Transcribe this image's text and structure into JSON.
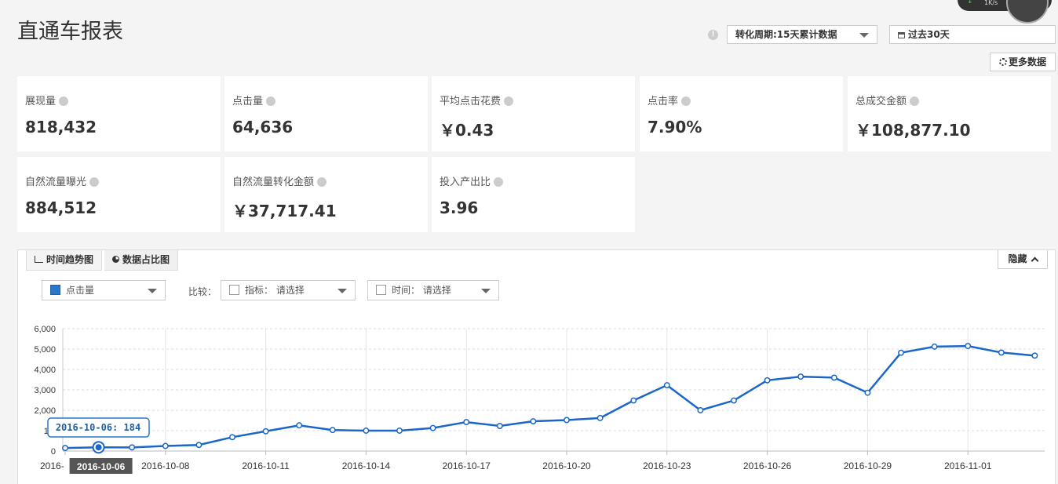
{
  "header": {
    "title": "直通车报表"
  },
  "speed": {
    "text": "1K/s"
  },
  "controls": {
    "period_label": "转化周期:15天累计数据",
    "range_label": "过去30天",
    "more_label": "更多数据"
  },
  "metrics": [
    {
      "label": "展现量",
      "value": "818,432"
    },
    {
      "label": "点击量",
      "value": "64,636"
    },
    {
      "label": "平均点击花费",
      "value": "￥0.43"
    },
    {
      "label": "点击率",
      "value": "7.90%"
    },
    {
      "label": "总成交金额",
      "value": "￥108,877.10"
    },
    {
      "label": "自然流量曝光",
      "value": "884,512"
    },
    {
      "label": "自然流量转化金额",
      "value": "￥37,717.41"
    },
    {
      "label": "投入产出比",
      "value": "3.96"
    }
  ],
  "chart_panel": {
    "tab_trend": "时间趋势图",
    "tab_share": "数据占比图",
    "hide_label": "隐藏",
    "metric_select": "点击量",
    "compare_label": "比较：",
    "compare_metric": "指标： 请选择",
    "compare_time": "时间： 请选择"
  },
  "colors": {
    "series": "#1a66c9",
    "tooltip_border": "#2b78c8",
    "date_badge_bg": "#555555"
  },
  "chart_data": {
    "type": "line",
    "series": [
      {
        "values": [
          150,
          184,
          180,
          250,
          300,
          680,
          970,
          1260,
          1030,
          1000,
          1000,
          1130,
          1420,
          1230,
          1460,
          1520,
          1620,
          2480,
          3230,
          2000,
          2480,
          3470,
          3650,
          3600,
          2860,
          4820,
          5120,
          5150,
          4830,
          4680
        ]
      }
    ],
    "x": [
      "2016-10-05",
      "2016-10-06",
      "2016-10-07",
      "2016-10-08",
      "2016-10-09",
      "2016-10-10",
      "2016-10-11",
      "2016-10-12",
      "2016-10-13",
      "2016-10-14",
      "2016-10-15",
      "2016-10-16",
      "2016-10-17",
      "2016-10-18",
      "2016-10-19",
      "2016-10-20",
      "2016-10-21",
      "2016-10-22",
      "2016-10-23",
      "2016-10-24",
      "2016-10-25",
      "2016-10-26",
      "2016-10-27",
      "2016-10-28",
      "2016-10-29",
      "2016-10-30",
      "2016-10-31",
      "2016-11-01",
      "2016-11-02",
      "2016-11-03"
    ],
    "x_tick_labels": [
      "2016-",
      "2016-10-08",
      "2016-10-11",
      "2016-10-14",
      "2016-10-17",
      "2016-10-20",
      "2016-10-23",
      "2016-10-26",
      "2016-10-29",
      "2016-11-01"
    ],
    "y_tick_labels": [
      "0",
      "1,0",
      "2,000",
      "3,000",
      "4,000",
      "5,000",
      "6,000"
    ],
    "ylim": [
      0,
      6000
    ],
    "grid": true,
    "tooltip_text": "2016-10-06: 184",
    "highlight_date": "2016-10-06"
  }
}
